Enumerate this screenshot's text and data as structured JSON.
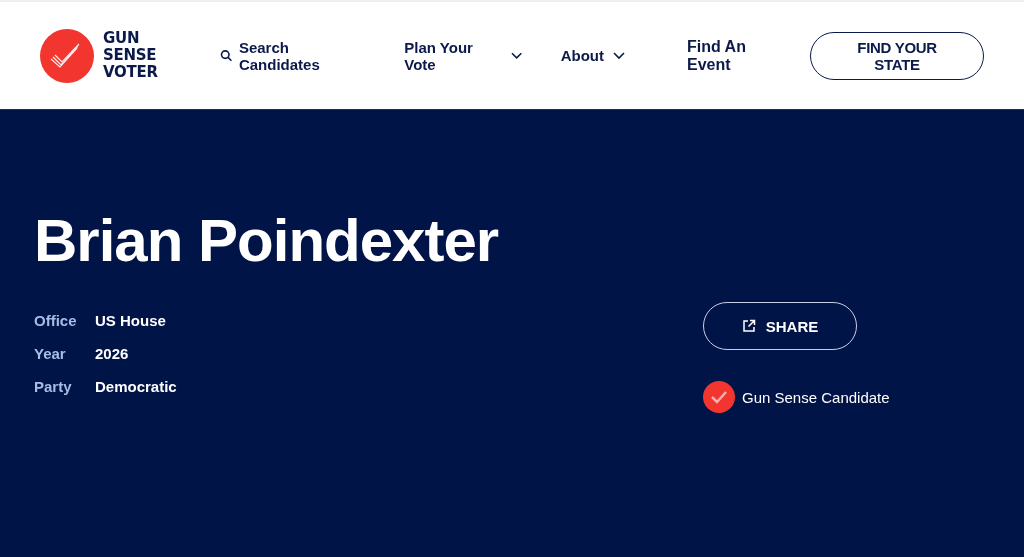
{
  "header": {
    "logo_lines": [
      "GUN",
      "SENSE",
      "VOTER"
    ],
    "nav": [
      {
        "label": "Search Candidates",
        "kind": "search"
      },
      {
        "label": "Plan Your Vote",
        "kind": "dropdown"
      },
      {
        "label": "About",
        "kind": "dropdown"
      },
      {
        "label": "Find An Event",
        "kind": "link"
      }
    ],
    "cta": "FIND YOUR STATE"
  },
  "candidate": {
    "name": "Brian Poindexter",
    "details": [
      {
        "label": "Office",
        "value": "US House"
      },
      {
        "label": "Year",
        "value": "2026"
      },
      {
        "label": "Party",
        "value": "Democratic"
      }
    ],
    "share": "SHARE",
    "badge": "Gun Sense Candidate"
  }
}
